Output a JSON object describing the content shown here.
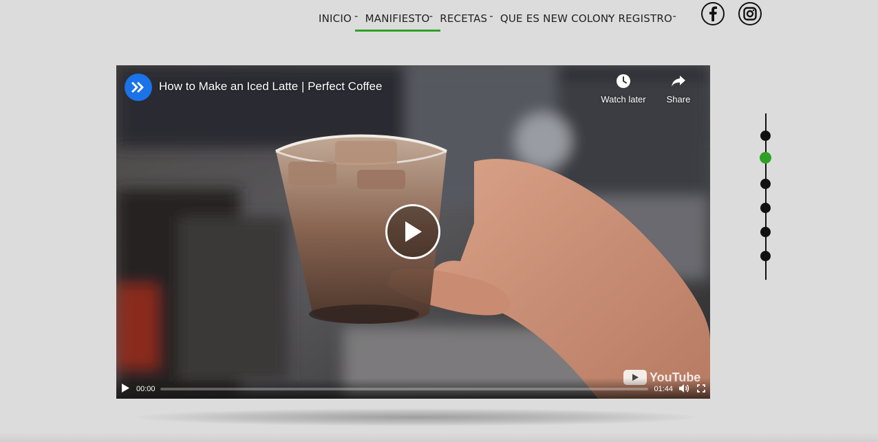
{
  "nav": {
    "items": [
      {
        "label": "INICIO",
        "active": false
      },
      {
        "label": "MANIFIESTO",
        "active": true
      },
      {
        "label": "RECETAS",
        "active": false
      },
      {
        "label": "QUE ES NEW COLONY",
        "active": false
      },
      {
        "label": "REGISTRO",
        "active": false
      }
    ],
    "separator": "-",
    "accent_color": "#2ea125"
  },
  "social": {
    "facebook_icon": "facebook-icon",
    "instagram_icon": "instagram-icon"
  },
  "video": {
    "title": "How to Make an Iced Latte | Perfect Coffee",
    "watch_later_label": "Watch later",
    "share_label": "Share",
    "current_time": "00:00",
    "duration": "01:44",
    "progress": 0,
    "wordmark": "YouTube"
  },
  "side_nav": {
    "dot_count": 6,
    "active_index": 1
  }
}
